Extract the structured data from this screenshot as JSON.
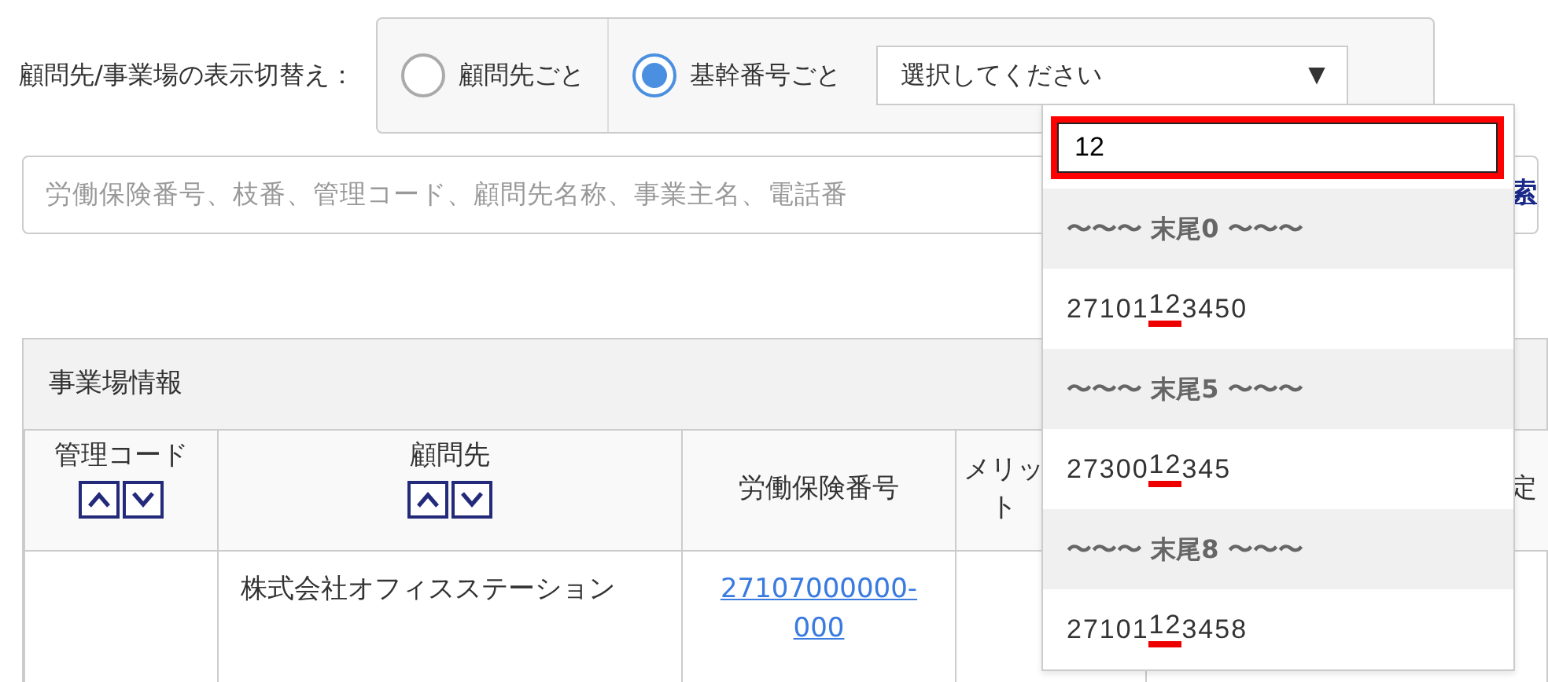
{
  "view_switch": {
    "label": "顧問先/事業場の表示切替え：",
    "options": [
      {
        "label": "顧問先ごと",
        "selected": false
      },
      {
        "label": "基幹番号ごと",
        "selected": true
      }
    ],
    "select": {
      "value": "選択してください",
      "caret": "▼"
    }
  },
  "search": {
    "placeholder": "労働保険番号、枝番、管理コード、顧問先名称、事業主名、電話番",
    "button": "索"
  },
  "dropdown": {
    "filter": {
      "value": "12",
      "highlighted": true
    },
    "items": [
      {
        "kind": "group",
        "label": "〜〜〜 末尾0 〜〜〜"
      },
      {
        "kind": "option",
        "before": "27101",
        "match": "12",
        "after": "3450"
      },
      {
        "kind": "group",
        "label": "〜〜〜 末尾5 〜〜〜"
      },
      {
        "kind": "option",
        "before": "27300",
        "match": "12",
        "after": "345"
      },
      {
        "kind": "group",
        "label": "〜〜〜 末尾8 〜〜〜"
      },
      {
        "kind": "option",
        "before": "27101",
        "match": "12",
        "after": "3458"
      }
    ]
  },
  "table": {
    "title": "事業場情報",
    "columns": [
      {
        "label": "管理コード",
        "sortable": true
      },
      {
        "label": "顧問先",
        "sortable": true
      },
      {
        "label": "労働保険番号",
        "sortable": false
      },
      {
        "label": "メリット",
        "sortable": false
      },
      {
        "label": "定",
        "sortable": false
      }
    ],
    "rows": [
      {
        "cells": [
          {
            "kind": "empty"
          },
          {
            "kind": "text",
            "text": "株式会社オフィスステーション"
          },
          {
            "kind": "link",
            "text": "27107000000-000"
          }
        ]
      }
    ]
  }
}
